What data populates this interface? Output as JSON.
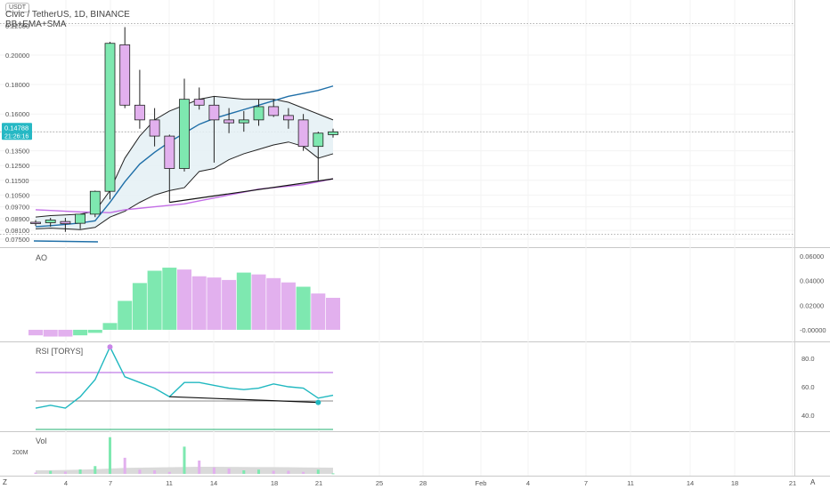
{
  "header": {
    "badge": "USDT",
    "title": "Civic / TetherUS, 1D, BINANCE",
    "indicators": "BB+EMA+SMA"
  },
  "price_tags": {
    "price": "0.14788",
    "countdown": "21:26:16"
  },
  "panes": {
    "ao": "AO",
    "rsi": "RSI [TORYS]",
    "vol": "Vol"
  },
  "controls": {
    "left": "Z",
    "right": "A"
  },
  "colors": {
    "up": "#7ee8b0",
    "down": "#e2b0ee",
    "bb_fill": "#e4f0f5",
    "ema": "#1f6fa8",
    "sma": "#c36ee6",
    "rsi": "#20b8c0",
    "rsi_upper": "#b05ce0",
    "rsi_lower": "#20b070",
    "tag": "#26b8c4"
  },
  "chart_data": [
    {
      "type": "candlestick",
      "title": "Civic / TetherUS, 1D, BINANCE",
      "price_axis_ticks": [
        "0.22000",
        "0.20000",
        "0.18000",
        "0.16000",
        "0.14788",
        "0.13500",
        "0.12500",
        "0.11500",
        "0.10500",
        "0.09700",
        "0.08900",
        "0.08100",
        "0.07500"
      ],
      "date_axis_ticks": [
        "4",
        "7",
        "11",
        "14",
        "18",
        "21",
        "25",
        "28",
        "Feb",
        "4",
        "7",
        "11",
        "14",
        "18",
        "21"
      ],
      "ylim": [
        0.072,
        0.235
      ],
      "candles": [
        {
          "o": 0.0865,
          "h": 0.088,
          "l": 0.084,
          "c": 0.086
        },
        {
          "o": 0.0862,
          "h": 0.0895,
          "l": 0.0835,
          "c": 0.088
        },
        {
          "o": 0.087,
          "h": 0.0895,
          "l": 0.08,
          "c": 0.0855
        },
        {
          "o": 0.0858,
          "h": 0.092,
          "l": 0.082,
          "c": 0.092
        },
        {
          "o": 0.092,
          "h": 0.108,
          "l": 0.09,
          "c": 0.1075
        },
        {
          "o": 0.1075,
          "h": 0.209,
          "l": 0.102,
          "c": 0.208
        },
        {
          "o": 0.207,
          "h": 0.219,
          "l": 0.164,
          "c": 0.166
        },
        {
          "o": 0.166,
          "h": 0.19,
          "l": 0.15,
          "c": 0.156
        },
        {
          "o": 0.156,
          "h": 0.164,
          "l": 0.138,
          "c": 0.145
        },
        {
          "o": 0.145,
          "h": 0.146,
          "l": 0.1,
          "c": 0.123
        },
        {
          "o": 0.123,
          "h": 0.184,
          "l": 0.121,
          "c": 0.17
        },
        {
          "o": 0.17,
          "h": 0.178,
          "l": 0.163,
          "c": 0.166
        },
        {
          "o": 0.166,
          "h": 0.172,
          "l": 0.127,
          "c": 0.156
        },
        {
          "o": 0.156,
          "h": 0.164,
          "l": 0.147,
          "c": 0.154
        },
        {
          "o": 0.154,
          "h": 0.162,
          "l": 0.148,
          "c": 0.156
        },
        {
          "o": 0.156,
          "h": 0.17,
          "l": 0.152,
          "c": 0.165
        },
        {
          "o": 0.165,
          "h": 0.17,
          "l": 0.158,
          "c": 0.159
        },
        {
          "o": 0.159,
          "h": 0.164,
          "l": 0.15,
          "c": 0.156
        },
        {
          "o": 0.156,
          "h": 0.16,
          "l": 0.135,
          "c": 0.138
        },
        {
          "o": 0.138,
          "h": 0.148,
          "l": 0.115,
          "c": 0.147
        },
        {
          "o": 0.146,
          "h": 0.15,
          "l": 0.144,
          "c": 0.1479
        }
      ],
      "bb_upper": [
        0.09,
        0.091,
        0.0915,
        0.092,
        0.094,
        0.108,
        0.13,
        0.145,
        0.156,
        0.162,
        0.166,
        0.17,
        0.172,
        0.171,
        0.17,
        0.17,
        0.17,
        0.168,
        0.164,
        0.16,
        0.156
      ],
      "bb_lower": [
        0.082,
        0.0825,
        0.082,
        0.0815,
        0.083,
        0.09,
        0.094,
        0.1,
        0.105,
        0.108,
        0.11,
        0.121,
        0.123,
        0.129,
        0.133,
        0.136,
        0.139,
        0.141,
        0.138,
        0.13,
        0.133
      ],
      "ema": [
        0.0835,
        0.0842,
        0.085,
        0.086,
        0.0875,
        0.1,
        0.114,
        0.126,
        0.134,
        0.141,
        0.147,
        0.153,
        0.157,
        0.16,
        0.163,
        0.166,
        0.169,
        0.172,
        0.174,
        0.176,
        0.179
      ],
      "sma": [
        0.095,
        0.0945,
        0.094,
        0.0935,
        0.0933,
        0.093,
        0.095,
        0.096,
        0.097,
        0.098,
        0.099,
        0.101,
        0.103,
        0.105,
        0.107,
        0.109,
        0.11,
        0.111,
        0.112,
        0.114,
        0.116
      ],
      "trendline": {
        "from_index": 9,
        "from_value": 0.1,
        "to_index": 20,
        "to_value": 0.116
      },
      "hlines": [
        0.2215,
        0.0784,
        0.1479
      ]
    },
    {
      "type": "bar",
      "title": "AO",
      "ticks": [
        "0.06000",
        "0.04000",
        "0.02000",
        "-0.00000"
      ],
      "ylim": [
        -0.008,
        0.065
      ],
      "values": [
        -0.0045,
        -0.0055,
        -0.0055,
        -0.0045,
        -0.0025,
        0.0055,
        0.0235,
        0.038,
        0.048,
        0.0505,
        0.049,
        0.0435,
        0.0425,
        0.0405,
        0.0465,
        0.045,
        0.042,
        0.0385,
        0.035,
        0.0295,
        0.026
      ],
      "up": [
        false,
        false,
        false,
        true,
        true,
        true,
        true,
        true,
        true,
        true,
        false,
        false,
        false,
        false,
        true,
        false,
        false,
        false,
        true,
        false,
        false
      ]
    },
    {
      "type": "line",
      "title": "RSI [TORYS]",
      "ticks": [
        "80.0",
        "60.0",
        "40.0"
      ],
      "ylim": [
        30,
        90
      ],
      "values": [
        45,
        47,
        45,
        53,
        65,
        88,
        67,
        63,
        59,
        53,
        63,
        63,
        61,
        59,
        58,
        59,
        62,
        60,
        59,
        52,
        54
      ],
      "upper": 70,
      "middle": 50,
      "lower": 30,
      "divergence": {
        "from_index": 9,
        "from_value": 53,
        "to_index": 19,
        "to_value": 49
      }
    },
    {
      "type": "bar",
      "title": "Vol",
      "ticks": [
        "200M"
      ],
      "ylim": [
        0,
        360
      ],
      "values": [
        12,
        28,
        20,
        40,
        70,
        330,
        145,
        38,
        32,
        18,
        245,
        120,
        58,
        48,
        32,
        38,
        28,
        28,
        18,
        38,
        5
      ],
      "ma": [
        32,
        33,
        35,
        38,
        42,
        48,
        54,
        56,
        58,
        60,
        62,
        64,
        64,
        63,
        62,
        61,
        61,
        60,
        58,
        57,
        56
      ]
    }
  ]
}
